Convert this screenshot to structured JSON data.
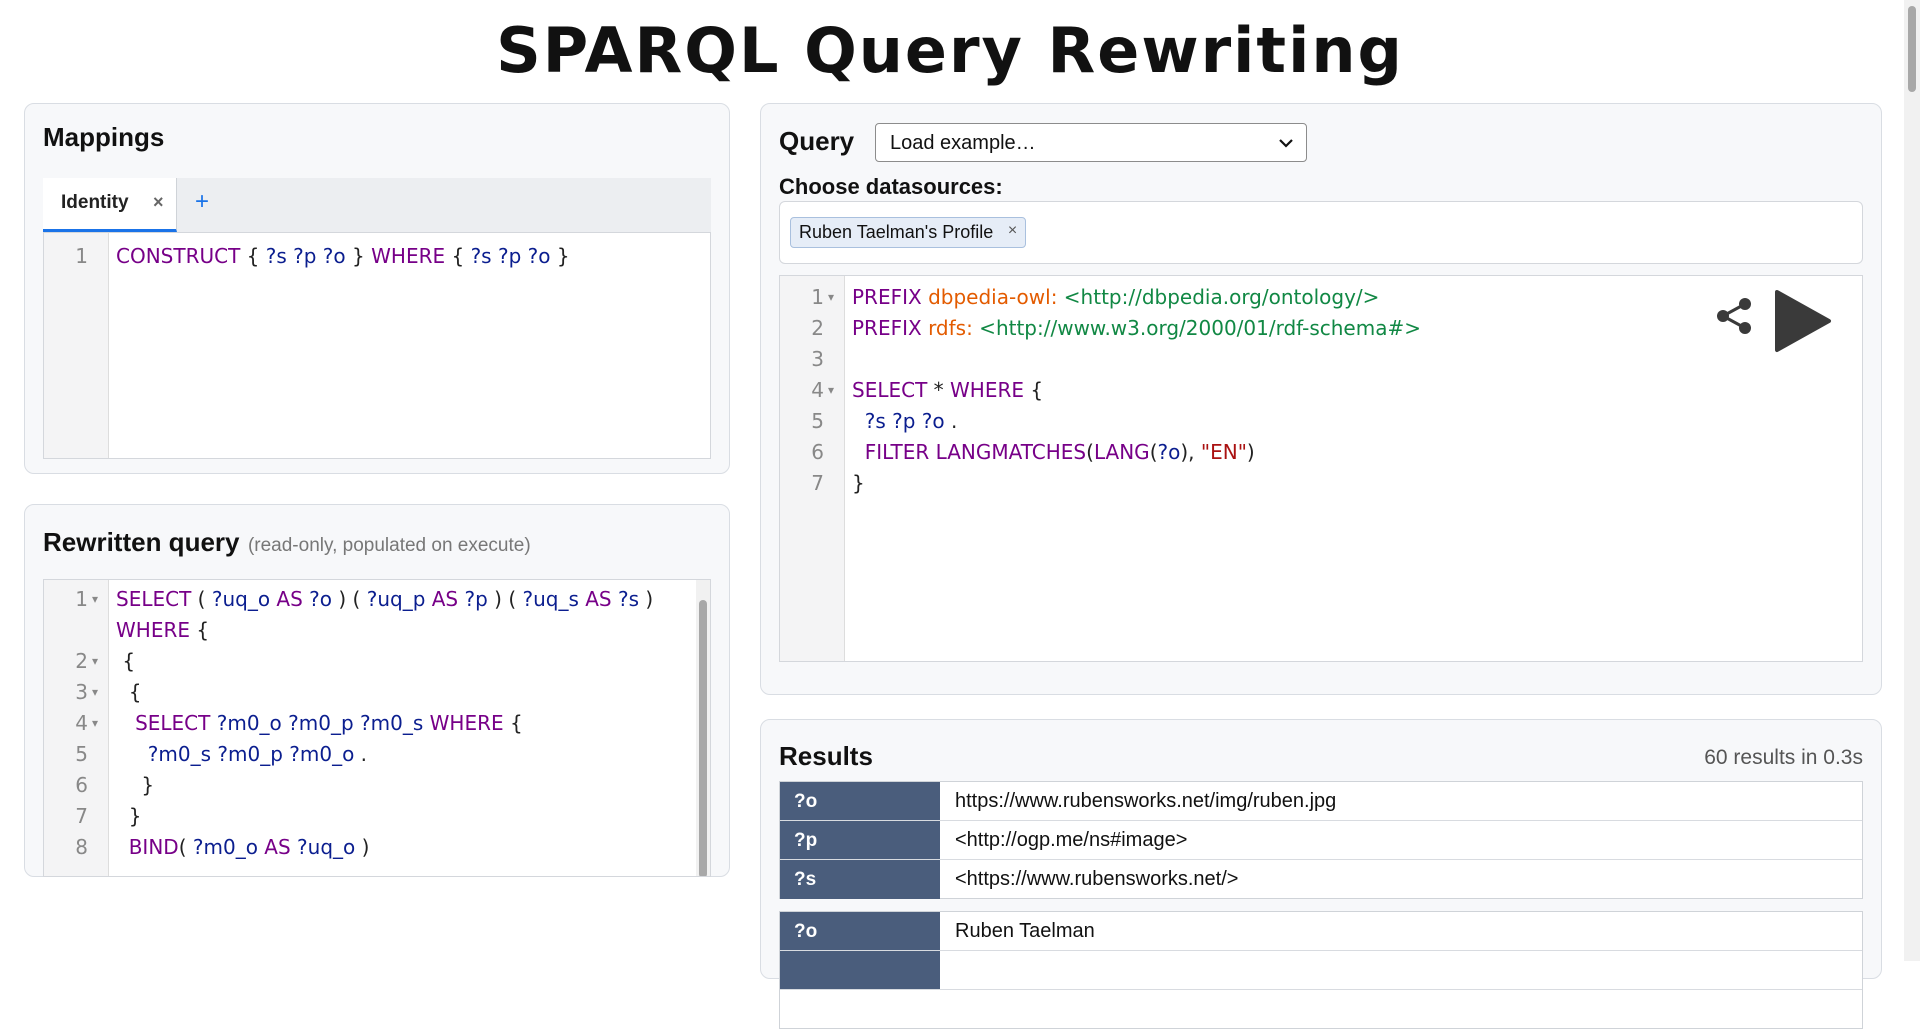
{
  "page": {
    "title": "SPARQL Query Rewriting"
  },
  "mappings": {
    "heading": "Mappings",
    "tabs": [
      {
        "label": "Identity",
        "close": "×"
      }
    ],
    "add_tab": "+",
    "editor_lines": [
      {
        "num": "1",
        "tokens": [
          {
            "c": "kw",
            "t": "CONSTRUCT"
          },
          {
            "c": "txt",
            "t": " { "
          },
          {
            "c": "var",
            "t": "?s ?p ?o"
          },
          {
            "c": "txt",
            "t": " } "
          },
          {
            "c": "kw",
            "t": "WHERE"
          },
          {
            "c": "txt",
            "t": " { "
          },
          {
            "c": "var",
            "t": "?s ?p ?o"
          },
          {
            "c": "txt",
            "t": " }"
          }
        ]
      }
    ]
  },
  "rewritten": {
    "heading": "Rewritten query",
    "note": "(read-only, populated on execute)",
    "editor_lines": [
      {
        "num": "1",
        "fold": "▾",
        "tokens": [
          {
            "c": "kw",
            "t": "SELECT"
          },
          {
            "c": "txt",
            "t": " ( "
          },
          {
            "c": "var",
            "t": "?uq_o"
          },
          {
            "c": "kw",
            "t": " AS "
          },
          {
            "c": "var",
            "t": "?o"
          },
          {
            "c": "txt",
            "t": " ) ( "
          },
          {
            "c": "var",
            "t": "?uq_p"
          },
          {
            "c": "kw",
            "t": " AS "
          },
          {
            "c": "var",
            "t": "?p"
          },
          {
            "c": "txt",
            "t": " ) ( "
          },
          {
            "c": "var",
            "t": "?uq_s"
          },
          {
            "c": "kw",
            "t": " AS "
          },
          {
            "c": "var",
            "t": "?s"
          },
          {
            "c": "txt",
            "t": " )"
          }
        ]
      },
      {
        "num": "",
        "fold": "",
        "tokens": [
          {
            "c": "kw",
            "t": "WHERE"
          },
          {
            "c": "txt",
            "t": " {"
          }
        ]
      },
      {
        "num": "2",
        "fold": "▾",
        "tokens": [
          {
            "c": "txt",
            "t": " {"
          }
        ]
      },
      {
        "num": "3",
        "fold": "▾",
        "tokens": [
          {
            "c": "txt",
            "t": "  {"
          }
        ]
      },
      {
        "num": "4",
        "fold": "▾",
        "tokens": [
          {
            "c": "kw",
            "t": "   SELECT"
          },
          {
            "c": "var",
            "t": " ?m0_o ?m0_p ?m0_s"
          },
          {
            "c": "kw",
            "t": " WHERE"
          },
          {
            "c": "txt",
            "t": " {"
          }
        ]
      },
      {
        "num": "5",
        "fold": "",
        "tokens": [
          {
            "c": "var",
            "t": "     ?m0_s ?m0_p ?m0_o"
          },
          {
            "c": "txt",
            "t": " ."
          }
        ]
      },
      {
        "num": "6",
        "fold": "",
        "tokens": [
          {
            "c": "txt",
            "t": "    }"
          }
        ]
      },
      {
        "num": "7",
        "fold": "",
        "tokens": [
          {
            "c": "txt",
            "t": "  }"
          }
        ]
      },
      {
        "num": "8",
        "fold": "",
        "tokens": [
          {
            "c": "kw",
            "t": "  BIND"
          },
          {
            "c": "txt",
            "t": "( "
          },
          {
            "c": "var",
            "t": "?m0_o"
          },
          {
            "c": "kw",
            "t": " AS "
          },
          {
            "c": "var",
            "t": "?uq_o"
          },
          {
            "c": "txt",
            "t": " )"
          }
        ]
      }
    ]
  },
  "query": {
    "heading": "Query",
    "example_select": "Load example…",
    "datasources_label": "Choose datasources:",
    "datasources": [
      {
        "label": "Ruben Taelman's Profile",
        "remove": "×"
      }
    ],
    "icons": {
      "share": "share-icon",
      "run": "play-icon"
    },
    "editor_lines": [
      {
        "num": "1",
        "fold": "▾",
        "tokens": [
          {
            "c": "kw",
            "t": "PREFIX "
          },
          {
            "c": "pfx",
            "t": "dbpedia-owl:"
          },
          {
            "c": "iri",
            "t": " <http://dbpedia.org/ontology/>"
          }
        ]
      },
      {
        "num": "2",
        "fold": "",
        "tokens": [
          {
            "c": "kw",
            "t": "PREFIX "
          },
          {
            "c": "pfx",
            "t": "rdfs:"
          },
          {
            "c": "iri",
            "t": " <http://www.w3.org/2000/01/rdf-schema#>"
          }
        ]
      },
      {
        "num": "3",
        "fold": "",
        "tokens": []
      },
      {
        "num": "4",
        "fold": "▾",
        "tokens": [
          {
            "c": "kw",
            "t": "SELECT"
          },
          {
            "c": "txt",
            "t": " * "
          },
          {
            "c": "kw",
            "t": "WHERE"
          },
          {
            "c": "txt",
            "t": " {"
          }
        ]
      },
      {
        "num": "5",
        "fold": "",
        "tokens": [
          {
            "c": "var",
            "t": "  ?s ?p ?o"
          },
          {
            "c": "txt",
            "t": " ."
          }
        ]
      },
      {
        "num": "6",
        "fold": "",
        "tokens": [
          {
            "c": "kw",
            "t": "  FILTER LANGMATCHES"
          },
          {
            "c": "txt",
            "t": "("
          },
          {
            "c": "kw",
            "t": "LANG"
          },
          {
            "c": "txt",
            "t": "("
          },
          {
            "c": "var",
            "t": "?o"
          },
          {
            "c": "txt",
            "t": "), "
          },
          {
            "c": "str",
            "t": "\"EN\""
          },
          {
            "c": "txt",
            "t": ")"
          }
        ]
      },
      {
        "num": "7",
        "fold": "",
        "tokens": [
          {
            "c": "txt",
            "t": "}"
          }
        ]
      }
    ]
  },
  "results": {
    "heading": "Results",
    "summary": "60 results in 0.3s",
    "groups": [
      [
        {
          "key": "?o",
          "value": "https://www.rubensworks.net/img/ruben.jpg"
        },
        {
          "key": "?p",
          "value": "<http://ogp.me/ns#image>"
        },
        {
          "key": "?s",
          "value": "<https://www.rubensworks.net/>"
        }
      ],
      [
        {
          "key": "?o",
          "value": "Ruben Taelman"
        },
        {
          "key": "",
          "value": ""
        }
      ]
    ]
  },
  "colors": {
    "accent": "#1a73e8",
    "result_key_bg": "#4a5d7c"
  }
}
